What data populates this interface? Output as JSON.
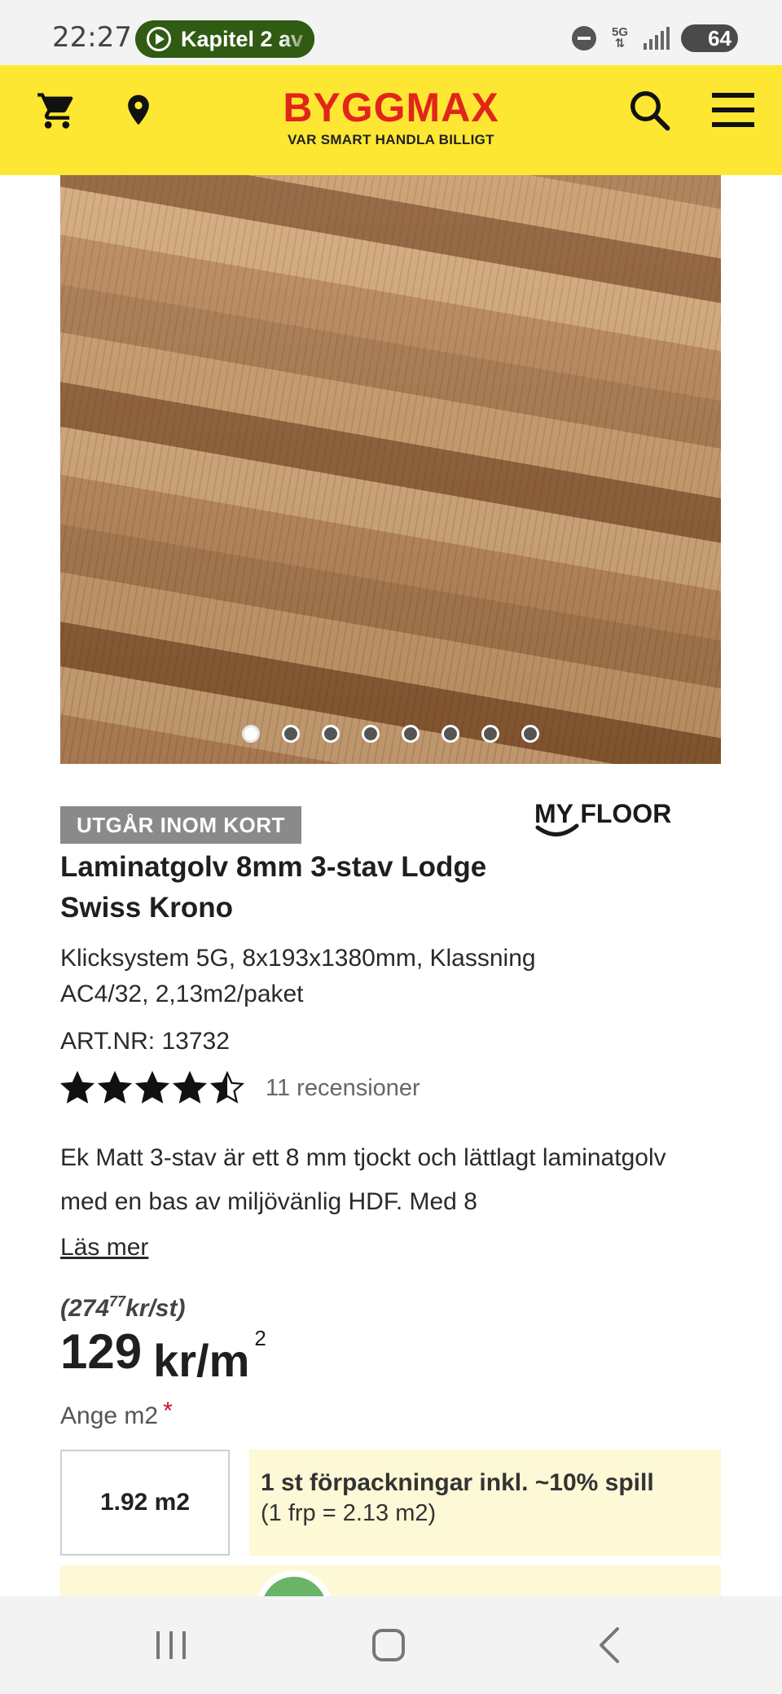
{
  "status_bar": {
    "time": "22:27",
    "media_pill": "Kapitel 2 av",
    "network": "5G",
    "battery": "64"
  },
  "header": {
    "logo": "BYGGMAX",
    "tagline": "VAR SMART HANDLA BILLIGT",
    "icons": [
      "cart-icon",
      "location-pin-icon",
      "search-icon",
      "menu-icon"
    ],
    "accent_color": "#fde733",
    "logo_color": "#e1251b"
  },
  "gallery": {
    "dot_count": 8,
    "active_index": 0
  },
  "product": {
    "badge": "UTGÅR INOM KORT",
    "brand": "MY FLOOR",
    "title": "Laminatgolv 8mm 3-stav Lodge Swiss Krono",
    "description": "Klicksystem 5G, 8x193x1380mm, Klassning AC4/32, 2,13m2/paket",
    "art_nr": "ART.NR: 13732",
    "rating": 4.5,
    "reviews": "11 recensioner",
    "long_description": "Ek Matt 3-stav är ett 8 mm tjockt och lättlagt laminatgolv med en bas av miljövänlig HDF. Med 8",
    "read_more": "Läs mer"
  },
  "pricing": {
    "unit_price_main": "(274",
    "unit_price_decimals": "77",
    "unit_price_suffix": "kr/st)",
    "price": "129",
    "price_unit": "kr/m",
    "price_exponent": "2"
  },
  "quantity": {
    "label": "Ange m2",
    "required_mark": "*",
    "value": "1.92 m2",
    "packages_text": "1 st förpackningar inkl. ~10% spill",
    "package_size": "(1 frp = 2.13 m2)"
  }
}
